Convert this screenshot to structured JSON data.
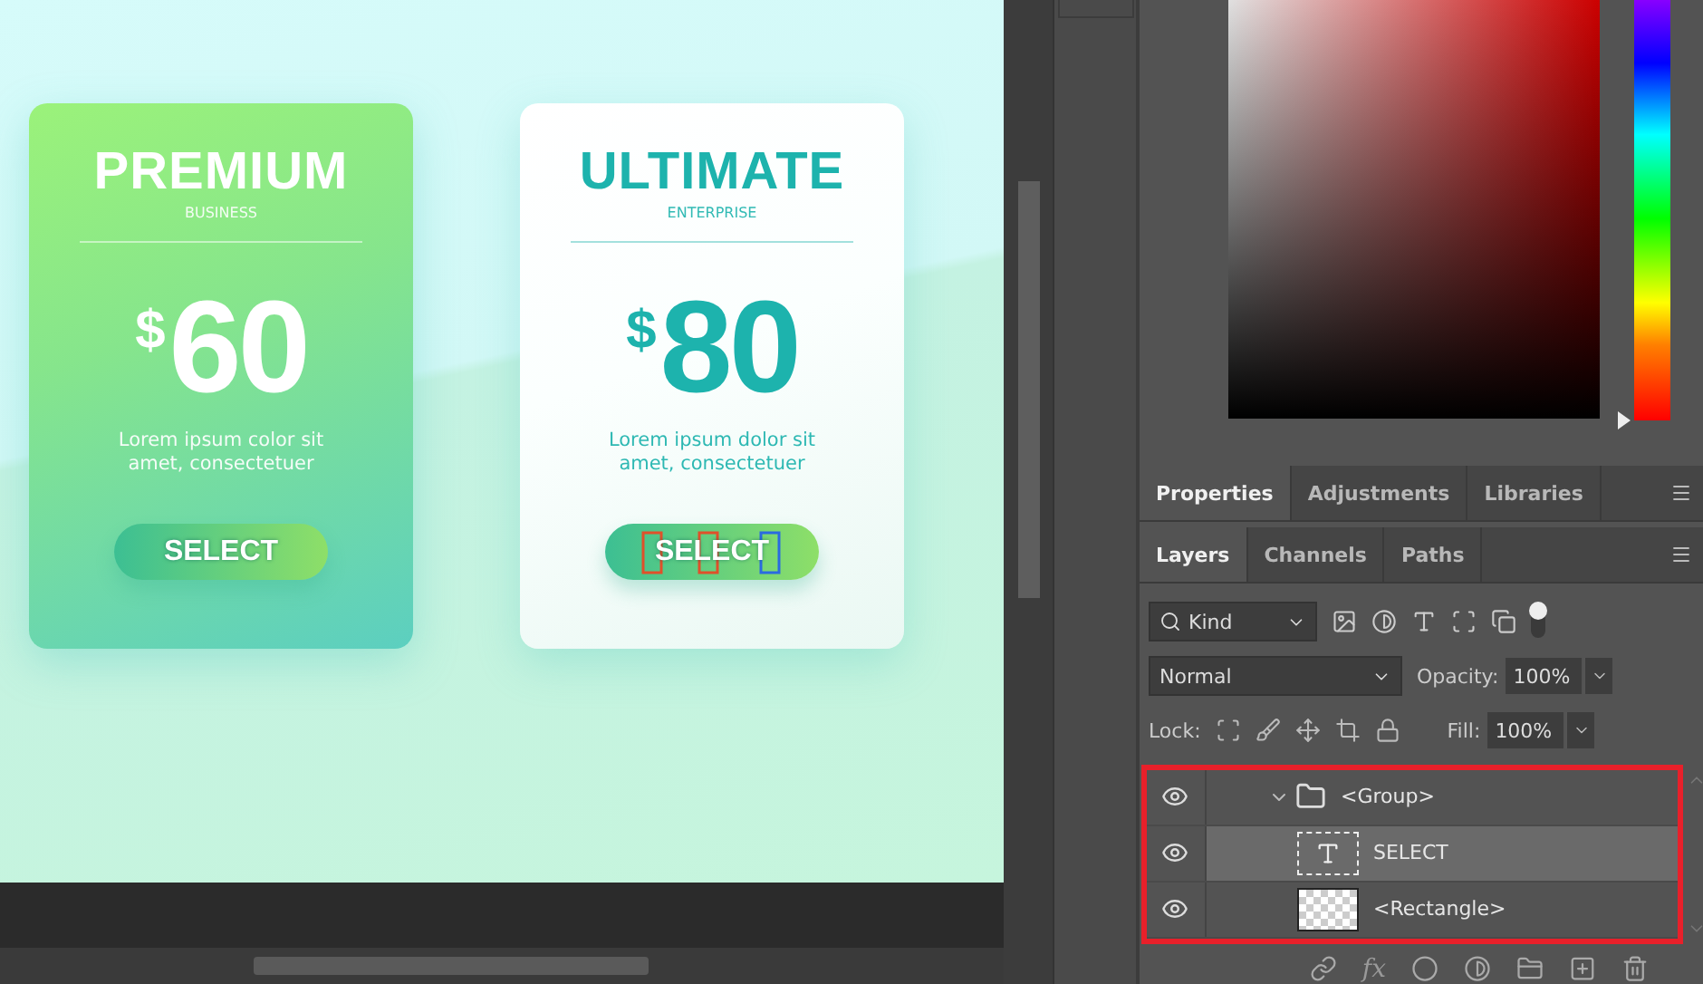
{
  "canvas": {
    "cards": [
      {
        "kind": "gradient",
        "title": "PREMIUM",
        "subtitle": "BUSINESS",
        "currency": "$",
        "price": "60",
        "description": "Lorem ipsum color sit amet, consectetuer",
        "button": "SELECT",
        "text_selected": false
      },
      {
        "kind": "light",
        "title": "ULTIMATE",
        "subtitle": "ENTERPRISE",
        "currency": "$",
        "price": "80",
        "description": "Lorem ipsum dolor sit amet, consectetuer",
        "button": "SELECT",
        "text_selected": true
      }
    ]
  },
  "color_picker": {
    "hue_slider": {
      "level": 0
    }
  },
  "panel_tabs": [
    {
      "label": "Properties",
      "selected": true
    },
    {
      "label": "Adjustments",
      "selected": false
    },
    {
      "label": "Libraries",
      "selected": false
    }
  ],
  "layers_panel": {
    "tabs": [
      {
        "label": "Layers",
        "selected": true
      },
      {
        "label": "Channels",
        "selected": false
      },
      {
        "label": "Paths",
        "selected": false
      }
    ],
    "filter": "Kind",
    "blend_mode": "Normal",
    "opacity_label": "Opacity:",
    "opacity": "100%",
    "lock_label": "Lock:",
    "fill_label": "Fill:",
    "fill": "100%",
    "layers": [
      {
        "kind": "group",
        "name": "<Group>",
        "visible": true,
        "selected": false,
        "expanded": true,
        "children": [
          {
            "kind": "text",
            "name": "SELECT",
            "visible": true,
            "selected": true
          },
          {
            "kind": "shape",
            "name": "<Rectangle>",
            "visible": true,
            "selected": false
          }
        ]
      }
    ],
    "effects_label": "fx"
  }
}
